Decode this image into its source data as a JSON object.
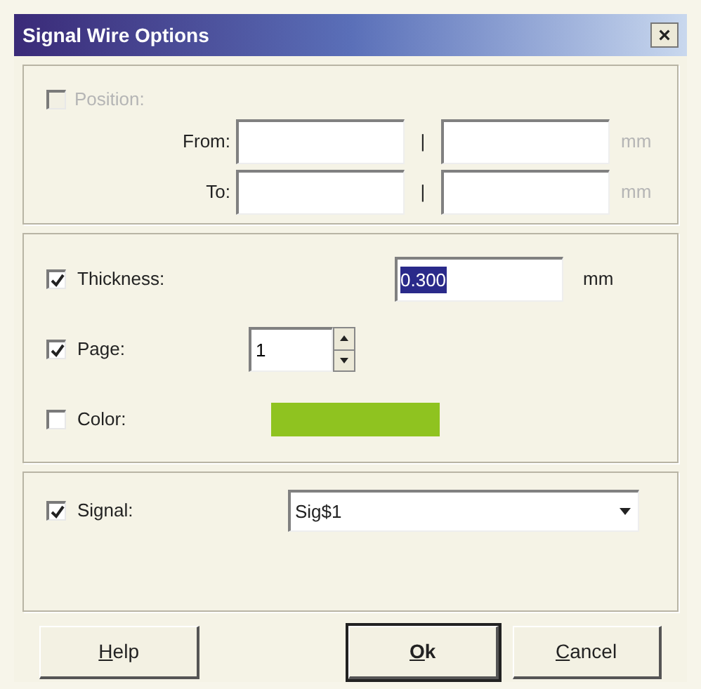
{
  "window": {
    "title": "Signal Wire Options",
    "close": "×"
  },
  "position": {
    "label": "Position:",
    "checked": false,
    "disabled": true,
    "rows": [
      {
        "label": "From:",
        "separator": "|",
        "unit": "mm"
      },
      {
        "label": "To:",
        "separator": "|",
        "unit": "mm"
      }
    ]
  },
  "thickness": {
    "label": "Thickness:",
    "checked": true,
    "value": "0.300",
    "text_selected": true,
    "unit": "mm"
  },
  "page": {
    "label": "Page:",
    "checked": true,
    "value": "1"
  },
  "color": {
    "label": "Color:",
    "checked": false,
    "color": "#8fc320"
  },
  "signal": {
    "label": "Signal:",
    "checked": true,
    "value": "Sig$1"
  },
  "buttons": [
    {
      "label": "Help",
      "underline_first": true,
      "default": false
    },
    {
      "label": "Ok",
      "underline_first": true,
      "default": true
    },
    {
      "label": "Cancel",
      "underline_first": true,
      "default": false
    }
  ]
}
